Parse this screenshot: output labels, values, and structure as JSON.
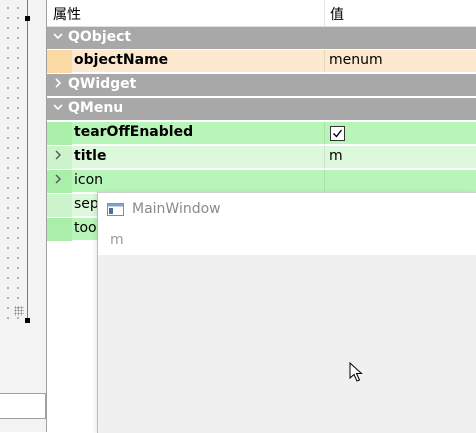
{
  "property_editor": {
    "header": {
      "property": "属性",
      "value": "值"
    },
    "rows": [
      {
        "name": "QObject",
        "value": ""
      },
      {
        "name": "objectName",
        "value": "menum"
      },
      {
        "name": "QWidget",
        "value": ""
      },
      {
        "name": "QMenu",
        "value": ""
      },
      {
        "name": "tearOffEnabled",
        "value": "",
        "checked": true
      },
      {
        "name": "title",
        "value": "m"
      },
      {
        "name": "icon",
        "value": ""
      },
      {
        "name": "sep",
        "value": ""
      },
      {
        "name": "too",
        "value": ""
      }
    ]
  },
  "preview_window": {
    "title": "MainWindow",
    "menu_item": "m"
  },
  "icons": {
    "expanded": "chevron-down-icon",
    "collapsed": "chevron-right-icon",
    "window": "window-icon",
    "cursor": "mouse-cursor-icon"
  },
  "colors": {
    "category": "#a8a8a8",
    "object_row": "#fde9cf",
    "menu_row": "#b8f5b8",
    "menu_row_alt": "#dcf9dc"
  }
}
